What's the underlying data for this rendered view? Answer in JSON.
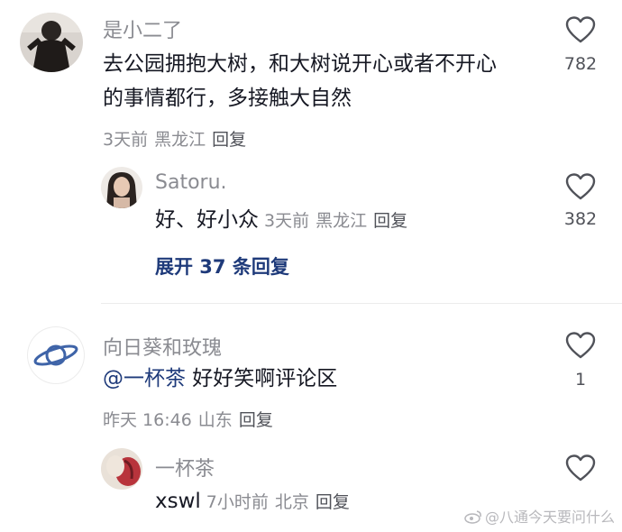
{
  "comments": [
    {
      "username": "是小二了",
      "text_line1": "去公园拥抱大树，和大树说开心或者不开心",
      "text_line2": "的事情都行，多接触大自然",
      "time": "3天前",
      "location": "黑龙江",
      "reply_label": "回复",
      "likes": "782"
    },
    {
      "username": "Satoru.",
      "text": "好、好小众",
      "time": "3天前",
      "location": "黑龙江",
      "reply_label": "回复",
      "likes": "382"
    },
    {
      "expand_label": "展开 37 条回复"
    },
    {
      "username": "向日葵和玫瑰",
      "mention": "@一杯茶",
      "text": " 好好笑啊评论区",
      "time": "昨天 16:46",
      "location": "山东",
      "reply_label": "回复",
      "likes": "1"
    },
    {
      "username": "一杯茶",
      "text": "xswl",
      "time": "7小时前",
      "location": "北京",
      "reply_label": "回复"
    }
  ],
  "watermark": "@八通今天要问什么",
  "colors": {
    "username": "#8a8b91",
    "text": "#161823",
    "link": "#1e3a7a",
    "heart_stroke": "#505259"
  },
  "icons": [
    "heart-outline-icon",
    "planet-icon",
    "weibo-icon"
  ]
}
